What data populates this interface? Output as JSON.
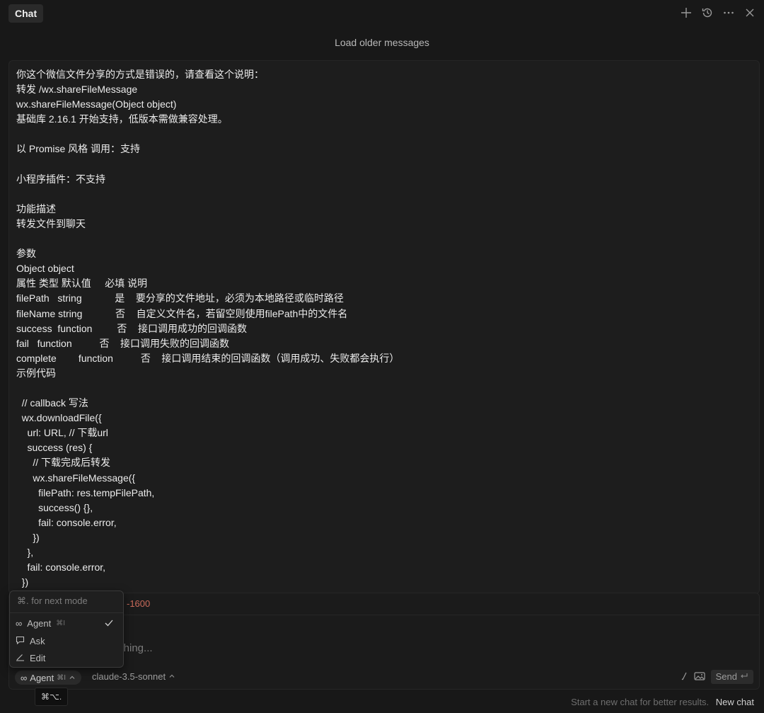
{
  "header": {
    "tab_label": "Chat",
    "icons": [
      "plus-icon",
      "history-icon",
      "more-icon",
      "close-icon"
    ]
  },
  "load_older_label": "Load older messages",
  "message": {
    "text": "你这个微信文件分享的方式是错误的，请查看这个说明：\n转发 /wx.shareFileMessage\nwx.shareFileMessage(Object object)\n基础库 2.16.1 开始支持，低版本需做兼容处理。\n\n以 Promise 风格 调用：支持\n\n小程序插件：不支持\n\n功能描述\n转发文件到聊天\n\n参数\nObject object\n属性 类型 默认值     必填 说明\nfilePath   string            是    要分享的文件地址，必须为本地路径或临时路径\nfileName string            否    自定义文件名，若留空则使用filePath中的文件名\nsuccess  function         否    接口调用成功的回调函数\nfail   function          否    接口调用失败的回调函数\ncomplete        function          否    接口调用结束的回调函数（调用成功、失败都会执行）\n示例代码\n\n  // callback 写法\n  wx.downloadFile({\n    url: URL, // 下载url\n    success (res) {\n      // 下载完成后转发\n      wx.shareFileMessage({\n        filePath: res.tempFilePath,\n        success() {},\n        fail: console.error,\n      })\n    },\n    fail: console.error,\n  })"
  },
  "input": {
    "context_text": "-1600",
    "placeholder": "ything...",
    "mode_label": "Agent",
    "mode_shortcut": "⌘I",
    "model_label": "claude-3.5-sonnet",
    "send_label": "Send",
    "send_icon": "enter-icon"
  },
  "mode_dropdown": {
    "hint": "⌘. for next mode",
    "items": [
      {
        "label": "Agent",
        "shortcut": "⌘I",
        "icon": "infinity-icon",
        "selected": true
      },
      {
        "label": "Ask",
        "shortcut": "",
        "icon": "chat-bubble-icon",
        "selected": false
      },
      {
        "label": "Edit",
        "shortcut": "",
        "icon": "pencil-icon",
        "selected": false
      }
    ]
  },
  "tooltip": "⌘⌥.",
  "footer": {
    "hint": "Start a new chat for better results.",
    "new_chat_label": "New chat"
  },
  "colors": {
    "background": "#181818",
    "context_text": "#c96a5a"
  }
}
